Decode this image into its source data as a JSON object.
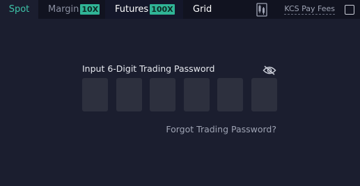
{
  "tabs": {
    "spot": "Spot",
    "margin": "Margin",
    "margin_badge": "10X",
    "futures": "Futures",
    "futures_badge": "100X",
    "grid": "Grid"
  },
  "toolbar": {
    "kcs_pay_fees": "KCS Pay Fees",
    "icons": [
      "calculator-icon"
    ],
    "kcs_checked": false
  },
  "password": {
    "title": "Input 6-Digit Trading Password",
    "digits": [
      "",
      "",
      "",
      "",
      "",
      ""
    ],
    "forgot": "Forgot Trading Password?"
  },
  "colors": {
    "accent": "#3ec4a9",
    "badge": "#30b596",
    "background": "#1b1e2f",
    "tabbar": "#111320",
    "input_box": "#2d303e"
  }
}
